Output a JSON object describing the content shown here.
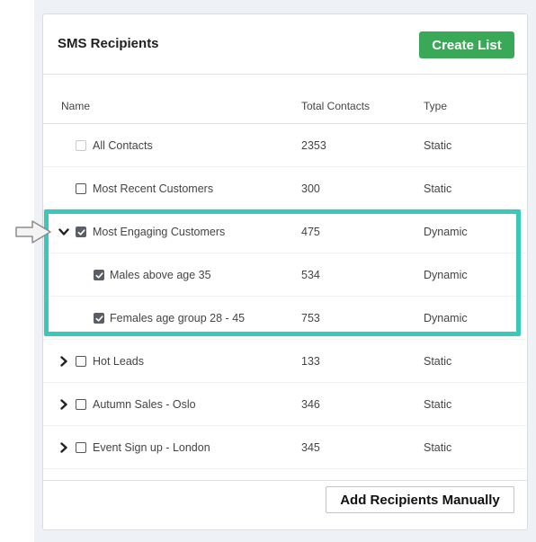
{
  "card": {
    "title": "SMS Recipients",
    "create_label": "Create List",
    "add_manual_label": "Add Recipients Manually"
  },
  "columns": [
    "Name",
    "Total Contacts",
    "Type"
  ],
  "rows": [
    {
      "name": "All Contacts",
      "total": "2353",
      "type": "Static",
      "checked": false,
      "disabled": true,
      "expander": "none",
      "child": false
    },
    {
      "name": "Most Recent Customers",
      "total": "300",
      "type": "Static",
      "checked": false,
      "disabled": false,
      "expander": "none",
      "child": false
    },
    {
      "name": "Most Engaging Customers",
      "total": "475",
      "type": "Dynamic",
      "checked": true,
      "disabled": false,
      "expander": "expanded",
      "child": false
    },
    {
      "name": "Males above age 35",
      "total": "534",
      "type": "Dynamic",
      "checked": true,
      "disabled": false,
      "expander": "none",
      "child": true
    },
    {
      "name": "Females age group 28 - 45",
      "total": "753",
      "type": "Dynamic",
      "checked": true,
      "disabled": false,
      "expander": "none",
      "child": true
    },
    {
      "name": "Hot Leads",
      "total": "133",
      "type": "Static",
      "checked": false,
      "disabled": false,
      "expander": "collapsed",
      "child": false
    },
    {
      "name": "Autumn Sales - Oslo",
      "total": "346",
      "type": "Static",
      "checked": false,
      "disabled": false,
      "expander": "collapsed",
      "child": false
    },
    {
      "name": "Event Sign up - London",
      "total": "345",
      "type": "Static",
      "checked": false,
      "disabled": false,
      "expander": "collapsed",
      "child": false
    }
  ],
  "colors": {
    "accent_green": "#3aa957",
    "highlight_teal": "#3ac8bb",
    "checkbox_checked": "#5a5f66"
  }
}
